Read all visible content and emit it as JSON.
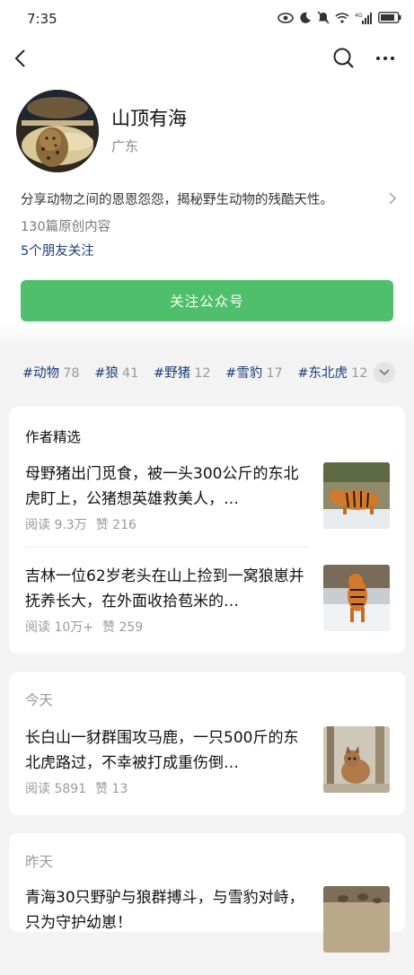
{
  "status": {
    "time": "7:35",
    "network": "4G",
    "battery_icon": "battery-icon"
  },
  "profile": {
    "name": "山顶有海",
    "region": "广东",
    "description": "分享动物之间的恩恩怨怨，揭秘野生动物的残酷天性。",
    "original_count": "130篇原创内容",
    "friends_following": "5个朋友关注",
    "follow_label": "关注公众号"
  },
  "tags": [
    {
      "name": "#动物",
      "count": "78"
    },
    {
      "name": "#狼",
      "count": "41"
    },
    {
      "name": "#野猪",
      "count": "12"
    },
    {
      "name": "#雪豹",
      "count": "17"
    },
    {
      "name": "#东北虎",
      "count": "12"
    }
  ],
  "featured": {
    "heading": "作者精选",
    "articles": [
      {
        "title": "母野猪出门觅食，被一头300公斤的东北虎盯上，公猪想英雄救美人，…",
        "reads": "阅读 9.3万",
        "likes": "赞 216"
      },
      {
        "title": "吉林一位62岁老头在山上捡到一窝狼崽并抚养长大，在外面收拾苞米的…",
        "reads": "阅读 10万+",
        "likes": "赞 259"
      }
    ]
  },
  "today": {
    "heading": "今天",
    "articles": [
      {
        "title": "长白山一豺群围攻马鹿，一只500斤的东北虎路过，不幸被打成重伤倒…",
        "reads": "阅读 5891",
        "likes": "赞 13"
      }
    ]
  },
  "yesterday": {
    "heading": "昨天",
    "articles": [
      {
        "title": "青海30只野驴与狼群搏斗，与雪豹对峙，只为守护幼崽！",
        "reads": "",
        "likes": ""
      }
    ]
  },
  "colors": {
    "accent_green": "#4fbf6b",
    "link_blue": "#1b3d7a",
    "muted": "#9a9a9a"
  }
}
